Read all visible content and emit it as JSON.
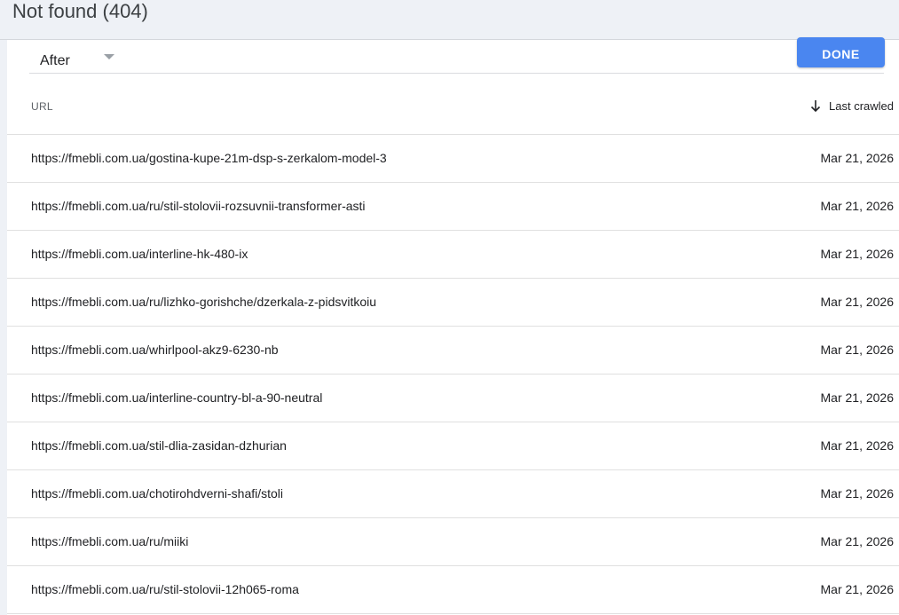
{
  "header": {
    "title": "Not found (404)"
  },
  "filter": {
    "selected": "After",
    "done_label": "DONE"
  },
  "table": {
    "columns": {
      "url": "URL",
      "last_crawled": "Last crawled",
      "sort_icon": "arrow-down-icon"
    },
    "rows": [
      {
        "url": "https://fmebli.com.ua/gostina-kupe-21m-dsp-s-zerkalom-model-3",
        "date": "Mar 21, 2026"
      },
      {
        "url": "https://fmebli.com.ua/ru/stil-stolovii-rozsuvnii-transformer-asti",
        "date": "Mar 21, 2026"
      },
      {
        "url": "https://fmebli.com.ua/interline-hk-480-ix",
        "date": "Mar 21, 2026"
      },
      {
        "url": "https://fmebli.com.ua/ru/lizhko-gorishche/dzerkala-z-pidsvitkoiu",
        "date": "Mar 21, 2026"
      },
      {
        "url": "https://fmebli.com.ua/whirlpool-akz9-6230-nb",
        "date": "Mar 21, 2026"
      },
      {
        "url": "https://fmebli.com.ua/interline-country-bl-a-90-neutral",
        "date": "Mar 21, 2026"
      },
      {
        "url": "https://fmebli.com.ua/stil-dlia-zasidan-dzhurian",
        "date": "Mar 21, 2026"
      },
      {
        "url": "https://fmebli.com.ua/chotirohdverni-shafi/stoli",
        "date": "Mar 21, 2026"
      },
      {
        "url": "https://fmebli.com.ua/ru/miiki",
        "date": "Mar 21, 2026"
      },
      {
        "url": "https://fmebli.com.ua/ru/stil-stolovii-12h065-roma",
        "date": "Mar 21, 2026"
      }
    ]
  },
  "colors": {
    "accent": "#4a86f0",
    "header_bg": "#eef1f6"
  }
}
